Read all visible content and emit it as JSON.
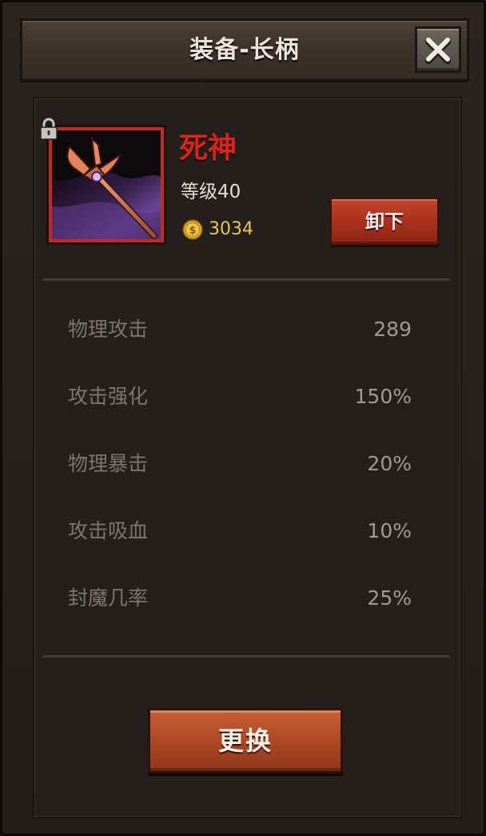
{
  "header": {
    "title": "装备-长柄",
    "close_icon": "close-icon"
  },
  "item": {
    "name": "死神",
    "name_color": "#d9241c",
    "level": "等级40",
    "price": "3034",
    "price_icon": "gold-coin-icon",
    "lock_icon": "lock-icon",
    "image_icon": "trident-icon",
    "frame_color": "#c42a22"
  },
  "actions": {
    "unequip_label": "卸下",
    "replace_label": "更换"
  },
  "stats": [
    {
      "label": "物理攻击",
      "value": "289"
    },
    {
      "label": "攻击强化",
      "value": "150%"
    },
    {
      "label": "物理暴击",
      "value": "20%"
    },
    {
      "label": "攻击吸血",
      "value": "10%"
    },
    {
      "label": "封魔几率",
      "value": "25%"
    }
  ]
}
